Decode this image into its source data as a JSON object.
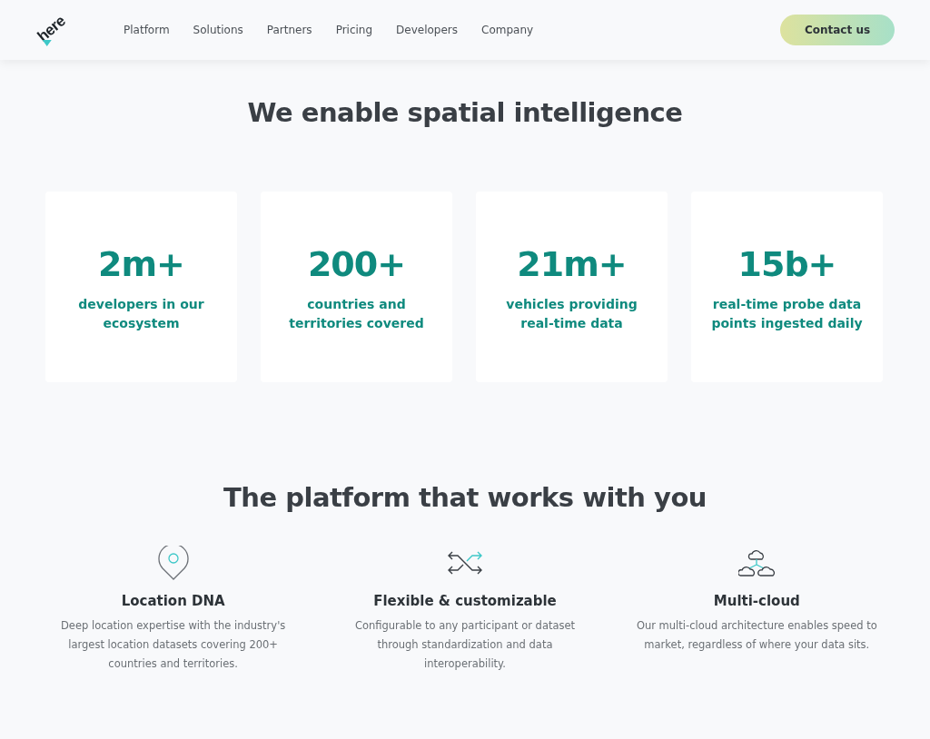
{
  "header": {
    "logo": "here",
    "nav": [
      {
        "label": "Platform"
      },
      {
        "label": "Solutions"
      },
      {
        "label": "Partners"
      },
      {
        "label": "Pricing"
      },
      {
        "label": "Developers"
      },
      {
        "label": "Company"
      }
    ],
    "cta": "Contact us"
  },
  "stats_section": {
    "title": "We enable spatial intelligence",
    "stats": [
      {
        "value": "2m+",
        "label": "developers in our ecosystem"
      },
      {
        "value": "200+",
        "label": "countries and territories covered"
      },
      {
        "value": "21m+",
        "label": "vehicles providing real-time data"
      },
      {
        "value": "15b+",
        "label": "real-time probe data points ingested daily"
      }
    ]
  },
  "platform_section": {
    "title": "The platform that works with you",
    "features": [
      {
        "kind": "pin",
        "title": "Location DNA",
        "text": "Deep location expertise with the industry's largest location datasets covering 200+ countries and territories."
      },
      {
        "kind": "shuffle",
        "title": "Flexible & customizable",
        "text": "Configurable to any participant or dataset through standardization and data interoperability."
      },
      {
        "kind": "cloud",
        "title": "Multi-cloud",
        "text": "Our multi-cloud architecture enables speed to market, regardless of where your data sits."
      }
    ]
  }
}
